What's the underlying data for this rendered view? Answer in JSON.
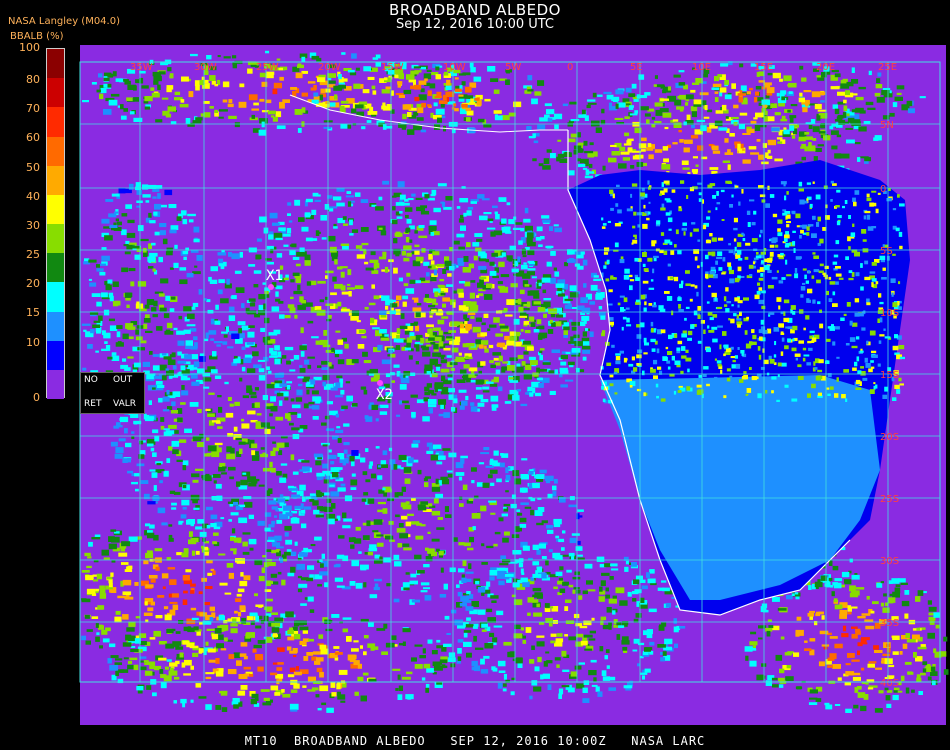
{
  "header": {
    "title": "BROADBAND ALBEDO",
    "subtitle": "Sep 12, 2016 10:00 UTC",
    "producer": "NASA Langley (M04.0)",
    "units": "BBALB (%)"
  },
  "colorbar": {
    "ticks": [
      "100",
      "80",
      "70",
      "60",
      "50",
      "40",
      "30",
      "25",
      "20",
      "15",
      "10",
      "0"
    ],
    "colors": [
      "#8b0000",
      "#cc0000",
      "#ff2a00",
      "#ff6a00",
      "#ffaa00",
      "#ffff00",
      "#88dd00",
      "#118811",
      "#00ffff",
      "#1e90ff",
      "#0000ff",
      "#8a2be2"
    ]
  },
  "legend": {
    "no": "NO",
    "out": "OUT",
    "ret": "RET",
    "valr": "VALR"
  },
  "markers": [
    {
      "label": "X1"
    },
    {
      "label": "X2"
    }
  ],
  "map": {
    "grid_color": "#40e0e0",
    "coast_color": "#ffffff",
    "marker_color": "#ff44ff",
    "lon_labels": [
      "45W",
      "40W",
      "35W",
      "30W",
      "25W",
      "20W",
      "15W",
      "10W",
      "5W",
      "0",
      "5E",
      "10E",
      "15E",
      "20E",
      "25E",
      "30E",
      "35E"
    ],
    "lat_labels": [
      "5N",
      "0",
      "5S",
      "10S",
      "15S",
      "20S",
      "25S",
      "30S",
      "35S",
      "40S"
    ]
  },
  "footer": "MT10  BROADBAND ALBEDO   SEP 12, 2016 10:00Z   NASA LARC"
}
